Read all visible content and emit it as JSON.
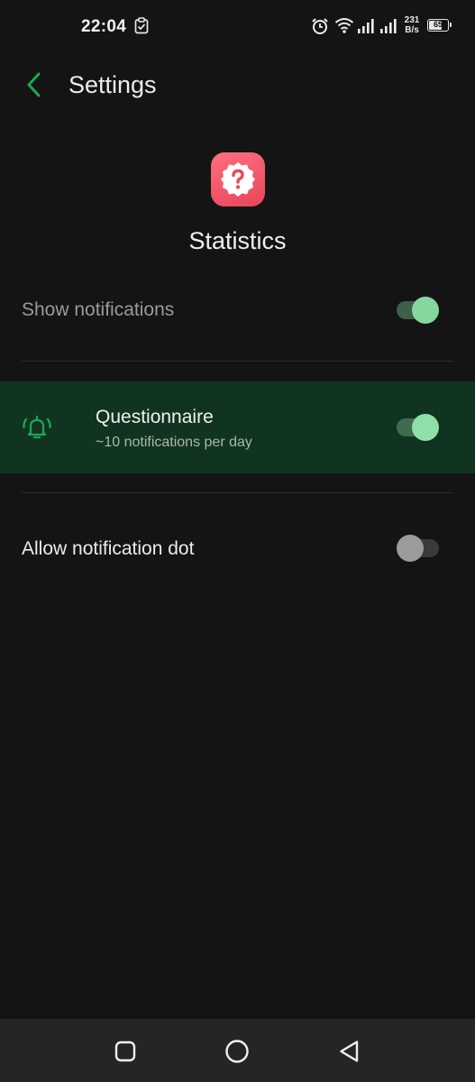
{
  "status_bar": {
    "time": "22:04",
    "net_speed_value": "231",
    "net_speed_unit": "B/s",
    "battery_level": "65",
    "icons": [
      "clipboard-check-icon",
      "alarm-icon",
      "wifi-icon",
      "signal-icon",
      "signal-icon",
      "battery-icon"
    ]
  },
  "header": {
    "title": "Settings",
    "back_icon": "chevron-left-icon"
  },
  "app": {
    "name": "Statistics",
    "icon": "question-badge-icon"
  },
  "settings": {
    "show_notifications": {
      "label": "Show notifications",
      "enabled": true
    },
    "questionnaire": {
      "label": "Questionnaire",
      "subtitle": "~10 notifications per day",
      "icon": "bell-ringing-icon",
      "enabled": true
    },
    "notification_dot": {
      "label": "Allow notification dot",
      "enabled": false
    }
  },
  "nav_bar": {
    "buttons": [
      "recents-square-icon",
      "home-circle-icon",
      "back-triangle-icon"
    ]
  },
  "colors": {
    "background": "#141414",
    "accent_green": "#1fa650",
    "toggle_on_thumb": "#8ee0a8",
    "highlight_row": "#113421",
    "app_icon": "#f0566a"
  }
}
